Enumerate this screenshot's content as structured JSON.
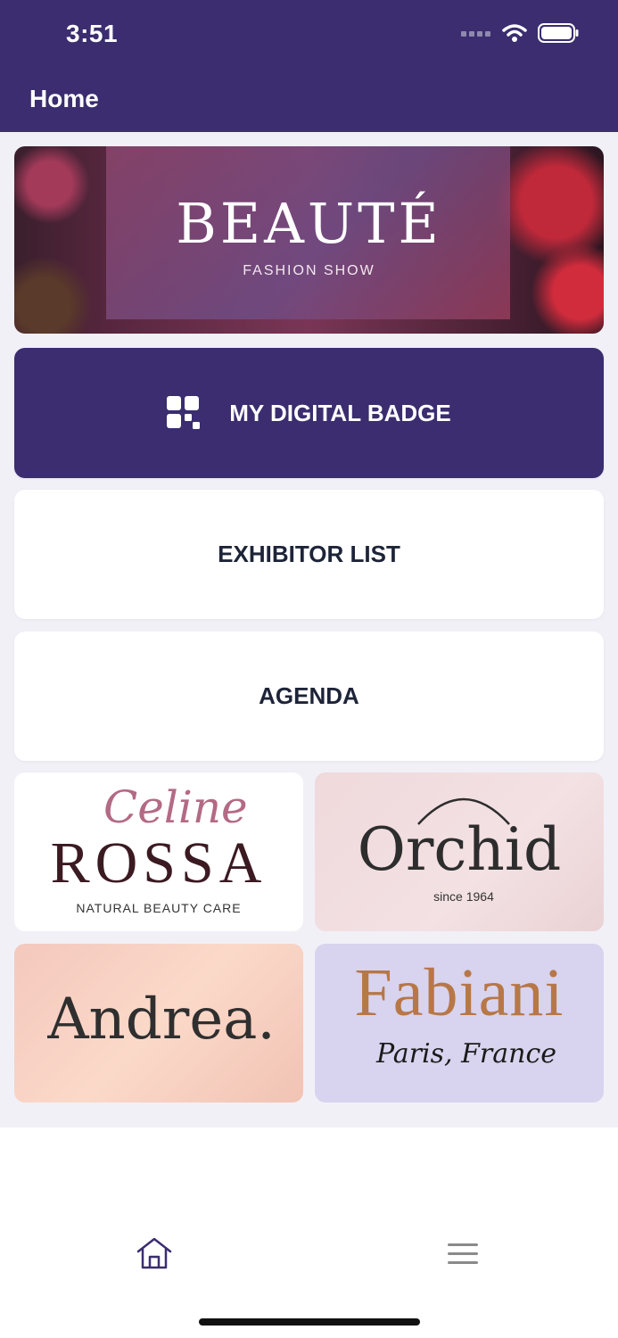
{
  "status_bar": {
    "time": "3:51"
  },
  "header": {
    "title": "Home"
  },
  "banner": {
    "title": "BEAUTÉ",
    "subtitle": "FASHION SHOW"
  },
  "buttons": {
    "badge": "MY DIGITAL BADGE",
    "exhibitor": "EXHIBITOR LIST",
    "agenda": "AGENDA"
  },
  "sponsors": {
    "celine": {
      "script": "Celine",
      "name": "ROSSA",
      "tagline": "NATURAL BEAUTY CARE"
    },
    "orchid": {
      "name": "Orchid",
      "tagline": "since 1964"
    },
    "andrea": {
      "name": "Andrea."
    },
    "fabiani": {
      "name": "Fabiani",
      "tagline": "Paris, France"
    }
  },
  "colors": {
    "brand": "#3b2d6f",
    "background": "#f1f0f7"
  },
  "tabbar": {
    "icons": [
      "home-icon",
      "menu-icon"
    ]
  }
}
